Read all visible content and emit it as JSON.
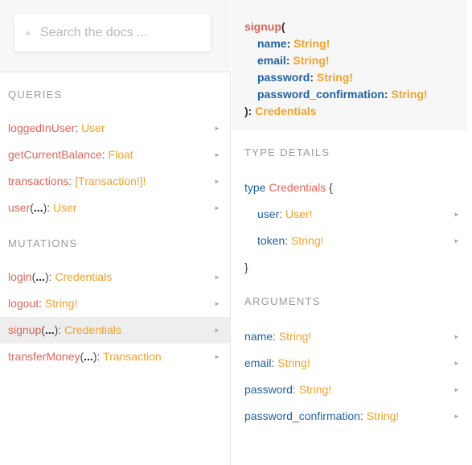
{
  "search": {
    "placeholder": "Search the docs ..."
  },
  "queries": {
    "title": "QUERIES",
    "items": [
      {
        "name": "loggedInUser",
        "args": "",
        "type": "User"
      },
      {
        "name": "getCurrentBalance",
        "args": "",
        "type": "Float"
      },
      {
        "name": "transactions",
        "args": "",
        "type": "[Transaction!]!"
      },
      {
        "name": "user",
        "args": "...",
        "type": "User"
      }
    ]
  },
  "mutations": {
    "title": "MUTATIONS",
    "items": [
      {
        "name": "login",
        "args": "...",
        "type": "Credentials"
      },
      {
        "name": "logout",
        "args": "",
        "type": "String!"
      },
      {
        "name": "signup",
        "args": "...",
        "type": "Credentials",
        "active": true
      },
      {
        "name": "transferMoney",
        "args": "...",
        "type": "Transaction"
      }
    ]
  },
  "signature": {
    "fn": "signup",
    "args": [
      {
        "name": "name",
        "type": "String!"
      },
      {
        "name": "email",
        "type": "String!"
      },
      {
        "name": "password",
        "type": "String!"
      },
      {
        "name": "password_confirmation",
        "type": "String!"
      }
    ],
    "return_type": "Credentials"
  },
  "type_details": {
    "title": "TYPE DETAILS",
    "keyword": "type",
    "type_name": "Credentials",
    "open_brace": "{",
    "close_brace": "}",
    "fields": [
      {
        "name": "user",
        "type": "User!"
      },
      {
        "name": "token",
        "type": "String!"
      }
    ]
  },
  "arguments": {
    "title": "ARGUMENTS",
    "items": [
      {
        "name": "name",
        "type": "String!"
      },
      {
        "name": "email",
        "type": "String!"
      },
      {
        "name": "password",
        "type": "String!"
      },
      {
        "name": "password_confirmation",
        "type": "String!"
      }
    ]
  },
  "icons": {
    "chevron": "chevron-right-icon"
  }
}
